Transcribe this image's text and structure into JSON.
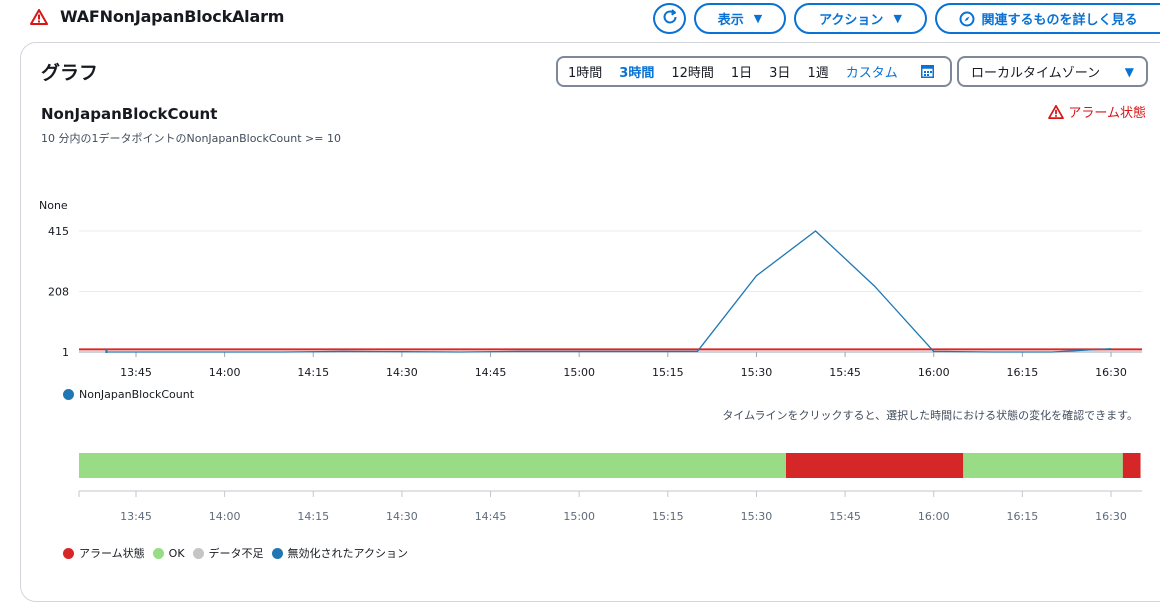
{
  "header": {
    "title": "WAFNonJapanBlockAlarm",
    "view_label": "表示",
    "action_label": "アクション",
    "related_label": "関連するものを詳しく見る"
  },
  "panel": {
    "title": "グラフ",
    "ranges": [
      "1時間",
      "3時間",
      "12時間",
      "1日",
      "3日",
      "1週"
    ],
    "active_range": "3時間",
    "custom_label": "カスタム",
    "timezone": "ローカルタイムゾーン"
  },
  "metric": {
    "title": "NonJapanBlockCount",
    "condition": "10 分内の1データポイントのNonJapanBlockCount >= 10",
    "alarm_state": "アラーム状態",
    "unit": "None"
  },
  "timeline_note": "タイムラインをクリックすると、選択した時間における状態の変化を確認できます。",
  "legend_states": [
    {
      "label": "アラーム状態",
      "color": "#d62728"
    },
    {
      "label": "OK",
      "color": "#98dc85"
    },
    {
      "label": "データ不足",
      "color": "#c5c5c5"
    },
    {
      "label": "無効化されたアクション",
      "color": "#1f77b4"
    }
  ],
  "colors": {
    "accent": "#0972d3",
    "alarm": "#d91515",
    "series": "#1f77b4",
    "threshold": "#d62728",
    "ok": "#98dc85"
  },
  "chart_data": {
    "type": "line",
    "ylabel": "None",
    "y_ticks": [
      1,
      208,
      415
    ],
    "ylim": [
      1,
      415
    ],
    "x_ticks": [
      "13:45",
      "14:00",
      "14:15",
      "14:30",
      "14:45",
      "15:00",
      "15:15",
      "15:30",
      "15:45",
      "16:00",
      "16:15",
      "16:30"
    ],
    "series": [
      {
        "name": "NonJapanBlockCount",
        "x": [
          "13:40",
          "14:10",
          "14:20",
          "14:30",
          "14:40",
          "14:50",
          "15:00",
          "15:10",
          "15:20",
          "15:30",
          "15:40",
          "15:50",
          "16:00",
          "16:10",
          "16:20",
          "16:30"
        ],
        "values": [
          1,
          1,
          3,
          2,
          1,
          3,
          3,
          3,
          3,
          262,
          415,
          226,
          3,
          1,
          1,
          12
        ]
      }
    ],
    "threshold": 10,
    "state_timeline": [
      {
        "state": "OK",
        "start": "13:35",
        "end": "15:35"
      },
      {
        "state": "アラーム状態",
        "start": "15:35",
        "end": "16:05"
      },
      {
        "state": "OK",
        "start": "16:05",
        "end": "16:32"
      },
      {
        "state": "アラーム状態",
        "start": "16:32",
        "end": "16:35"
      }
    ]
  }
}
